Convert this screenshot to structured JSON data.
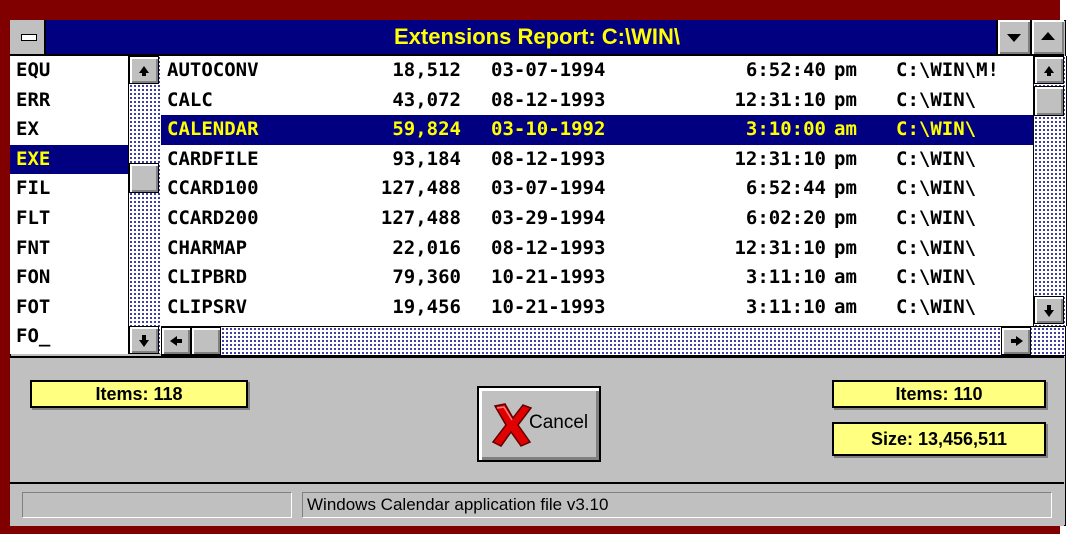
{
  "window": {
    "title": "Extensions Report: C:\\WIN\\"
  },
  "extensions": [
    "EQU",
    "ERR",
    "EX",
    "EXE",
    "FIL",
    "FLT",
    "FNT",
    "FON",
    "FOT",
    "FO_"
  ],
  "selected_extension": "EXE",
  "files": [
    {
      "name": "AUTOCONV",
      "size": "18,512",
      "date": "03-07-1994",
      "time": "6:52:40",
      "ampm": "pm",
      "path": "C:\\WIN\\M!"
    },
    {
      "name": "CALC",
      "size": "43,072",
      "date": "08-12-1993",
      "time": "12:31:10",
      "ampm": "pm",
      "path": "C:\\WIN\\"
    },
    {
      "name": "CALENDAR",
      "size": "59,824",
      "date": "03-10-1992",
      "time": "3:10:00",
      "ampm": "am",
      "path": "C:\\WIN\\"
    },
    {
      "name": "CARDFILE",
      "size": "93,184",
      "date": "08-12-1993",
      "time": "12:31:10",
      "ampm": "pm",
      "path": "C:\\WIN\\"
    },
    {
      "name": "CCARD100",
      "size": "127,488",
      "date": "03-07-1994",
      "time": "6:52:44",
      "ampm": "pm",
      "path": "C:\\WIN\\"
    },
    {
      "name": "CCARD200",
      "size": "127,488",
      "date": "03-29-1994",
      "time": "6:02:20",
      "ampm": "pm",
      "path": "C:\\WIN\\"
    },
    {
      "name": "CHARMAP",
      "size": "22,016",
      "date": "08-12-1993",
      "time": "12:31:10",
      "ampm": "pm",
      "path": "C:\\WIN\\"
    },
    {
      "name": "CLIPBRD",
      "size": "79,360",
      "date": "10-21-1993",
      "time": "3:11:10",
      "ampm": "am",
      "path": "C:\\WIN\\"
    },
    {
      "name": "CLIPSRV",
      "size": "19,456",
      "date": "10-21-1993",
      "time": "3:11:10",
      "ampm": "am",
      "path": "C:\\WIN\\"
    }
  ],
  "selected_file": "CALENDAR",
  "left_items_label": "Items: 118",
  "right_items_label": "Items: 110",
  "size_label": "Size: 13,456,511",
  "cancel_label": "Cancel",
  "status_left": "",
  "status_text": "Windows Calendar application file v3.10",
  "colors": {
    "frame": "#800000",
    "titlebar": "#000080",
    "title_text": "#ffff00",
    "selection": "#000080",
    "badge": "#ffff80",
    "face": "#c0c0c0"
  },
  "icons": [
    "system-menu-icon",
    "minimize-icon",
    "maximize-icon",
    "scroll-up-icon",
    "scroll-down-icon",
    "scroll-left-icon",
    "scroll-right-icon",
    "cancel-x-icon"
  ]
}
